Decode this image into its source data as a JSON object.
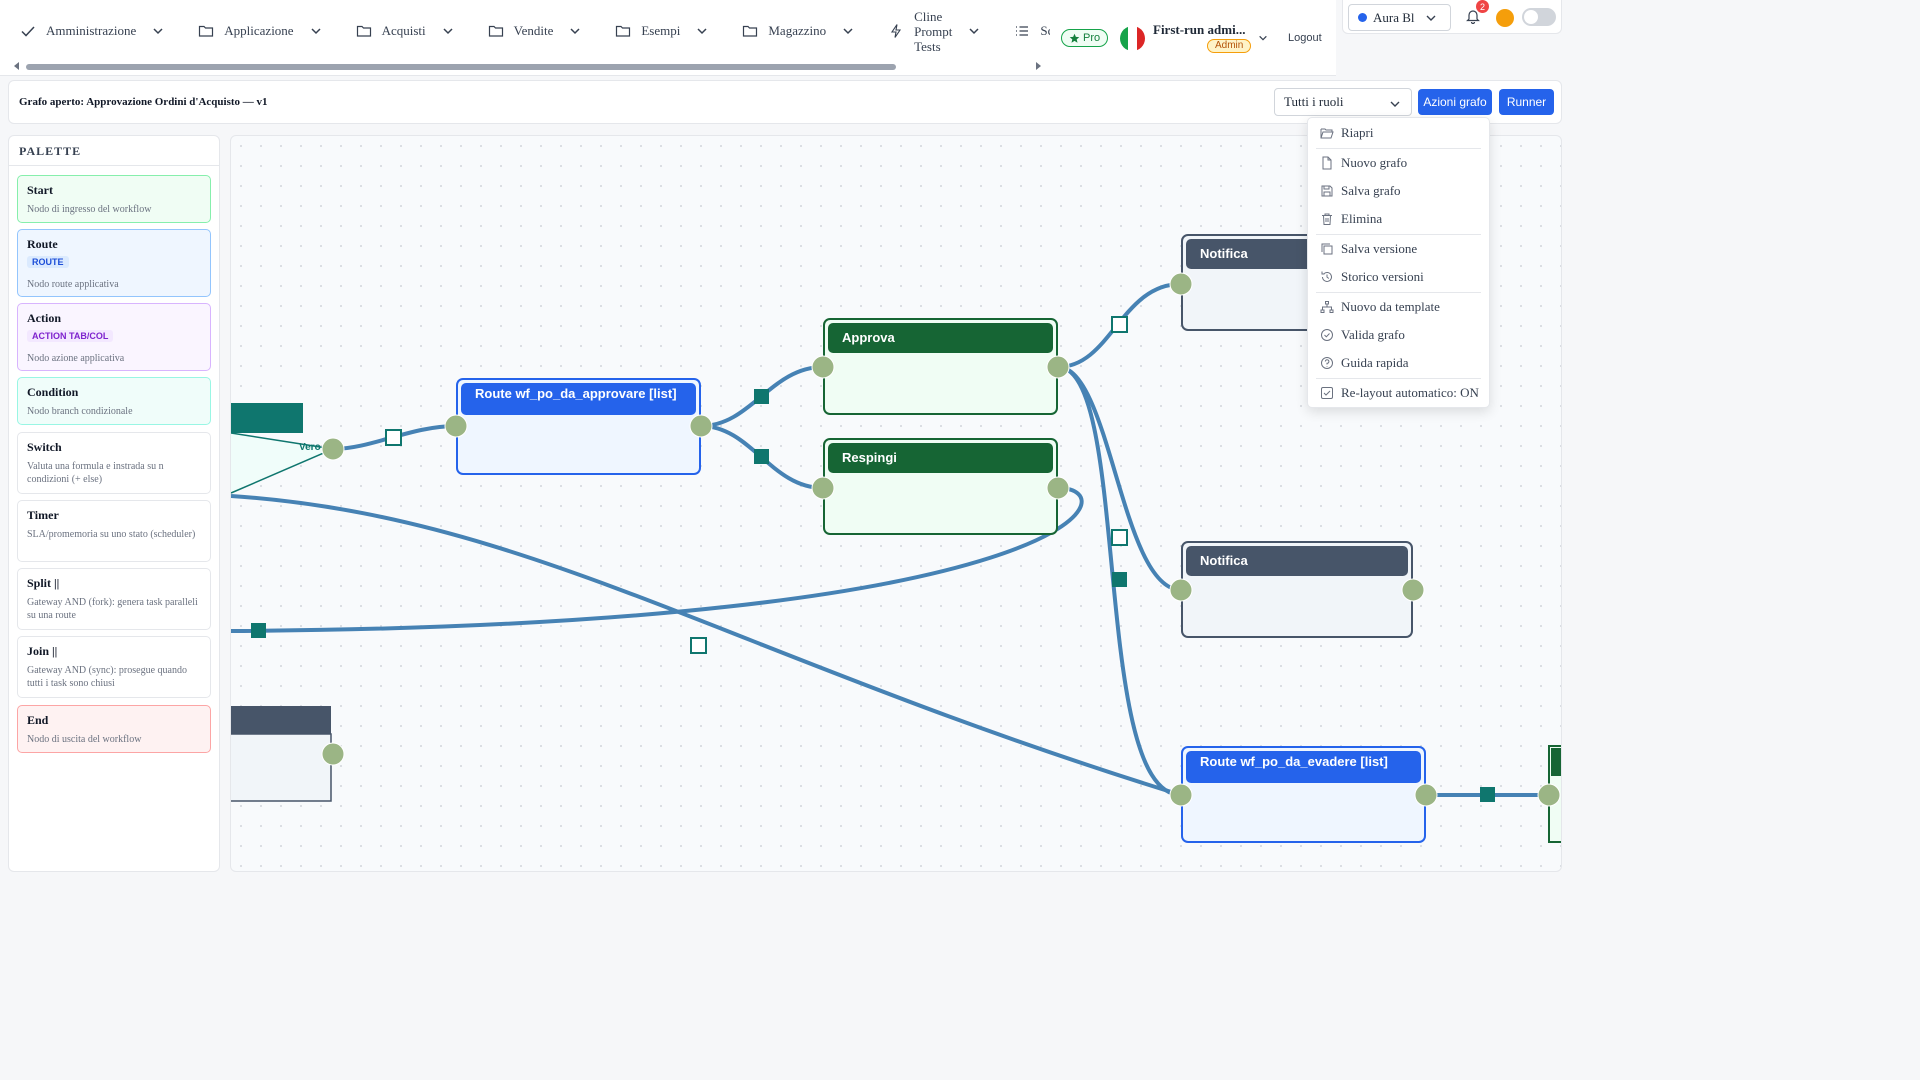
{
  "menu": {
    "items": [
      {
        "label": "Amministrazione",
        "icon": "check-icon"
      },
      {
        "label": "Applicazione",
        "icon": "folder-icon"
      },
      {
        "label": "Acquisti",
        "icon": "folder-icon"
      },
      {
        "label": "Vendite",
        "icon": "folder-icon"
      },
      {
        "label": "Esempi",
        "icon": "folder-icon"
      },
      {
        "label": "Magazzino",
        "icon": "folder-icon"
      },
      {
        "label_lines": [
          "Cline",
          "Prompt",
          "Tests"
        ],
        "icon": "bolt-icon"
      },
      {
        "label": "Scadenz",
        "icon": "list-icon"
      }
    ]
  },
  "header": {
    "pro_label": "Pro",
    "user_name": "First-run admi...",
    "user_role": "Admin",
    "logout_label": "Logout",
    "theme_label": "Aura Bl",
    "notifications_count": "2"
  },
  "graphbar": {
    "title": "Grafo aperto: Approvazione Ordini d'Acquisto — v1",
    "role_select_value": "Tutti i ruoli",
    "actions_button": "Azioni grafo",
    "runner_button": "Runner"
  },
  "palette": {
    "heading": "PALETTE",
    "items": [
      {
        "title": "Start",
        "desc": "Nodo di ingresso del workflow"
      },
      {
        "title": "Route",
        "tag": "ROUTE",
        "desc": "Nodo route applicativa"
      },
      {
        "title": "Action",
        "tag": "ACTION TAB/COL",
        "desc": "Nodo azione applicativa"
      },
      {
        "title": "Condition",
        "desc": "Nodo branch condizionale"
      },
      {
        "title": "Switch",
        "desc": "Valuta una formula e instrada su n condizioni (+ else)"
      },
      {
        "title": "Timer",
        "desc": "SLA/promemoria su uno stato (scheduler)"
      },
      {
        "title": "Split ||",
        "desc": "Gateway AND (fork): genera task paralleli su una route"
      },
      {
        "title": "Join ||",
        "desc": "Gateway AND (sync): prosegue quando tutti i task sono chiusi"
      },
      {
        "title": "End",
        "desc": "Nodo di uscita del workflow"
      }
    ]
  },
  "canvas": {
    "edge_label_true": "Vero",
    "nodes": {
      "route_approvare": "Route wf_po_da_approvare [list]",
      "approva": "Approva",
      "respingi": "Respingi",
      "notifica_1": "Notifica",
      "notifica_2": "Notifica",
      "route_evadere": "Route wf_po_da_evadere [list]"
    }
  },
  "dropdown": {
    "items": [
      {
        "label": "Riapri",
        "icon": "folder-open-icon"
      },
      {
        "label": "Nuovo grafo",
        "icon": "file-icon"
      },
      {
        "label": "Salva grafo",
        "icon": "save-icon"
      },
      {
        "label": "Elimina",
        "icon": "trash-icon"
      },
      {
        "label": "Salva versione",
        "icon": "copy-icon"
      },
      {
        "label": "Storico versioni",
        "icon": "history-icon"
      },
      {
        "label": "Nuovo da template",
        "icon": "sitemap-icon"
      },
      {
        "label": "Valida grafo",
        "icon": "check-circle-icon"
      },
      {
        "label": "Guida rapida",
        "icon": "question-icon"
      },
      {
        "label": "Re-layout automatico: ON",
        "icon": "checkbox-icon"
      }
    ]
  },
  "colors": {
    "primary": "#2563eb",
    "action_green": "#166534",
    "notify_slate": "#475569",
    "edge": "#4682b4",
    "port": "#9bb585",
    "connector_teal": "#0f766e"
  }
}
